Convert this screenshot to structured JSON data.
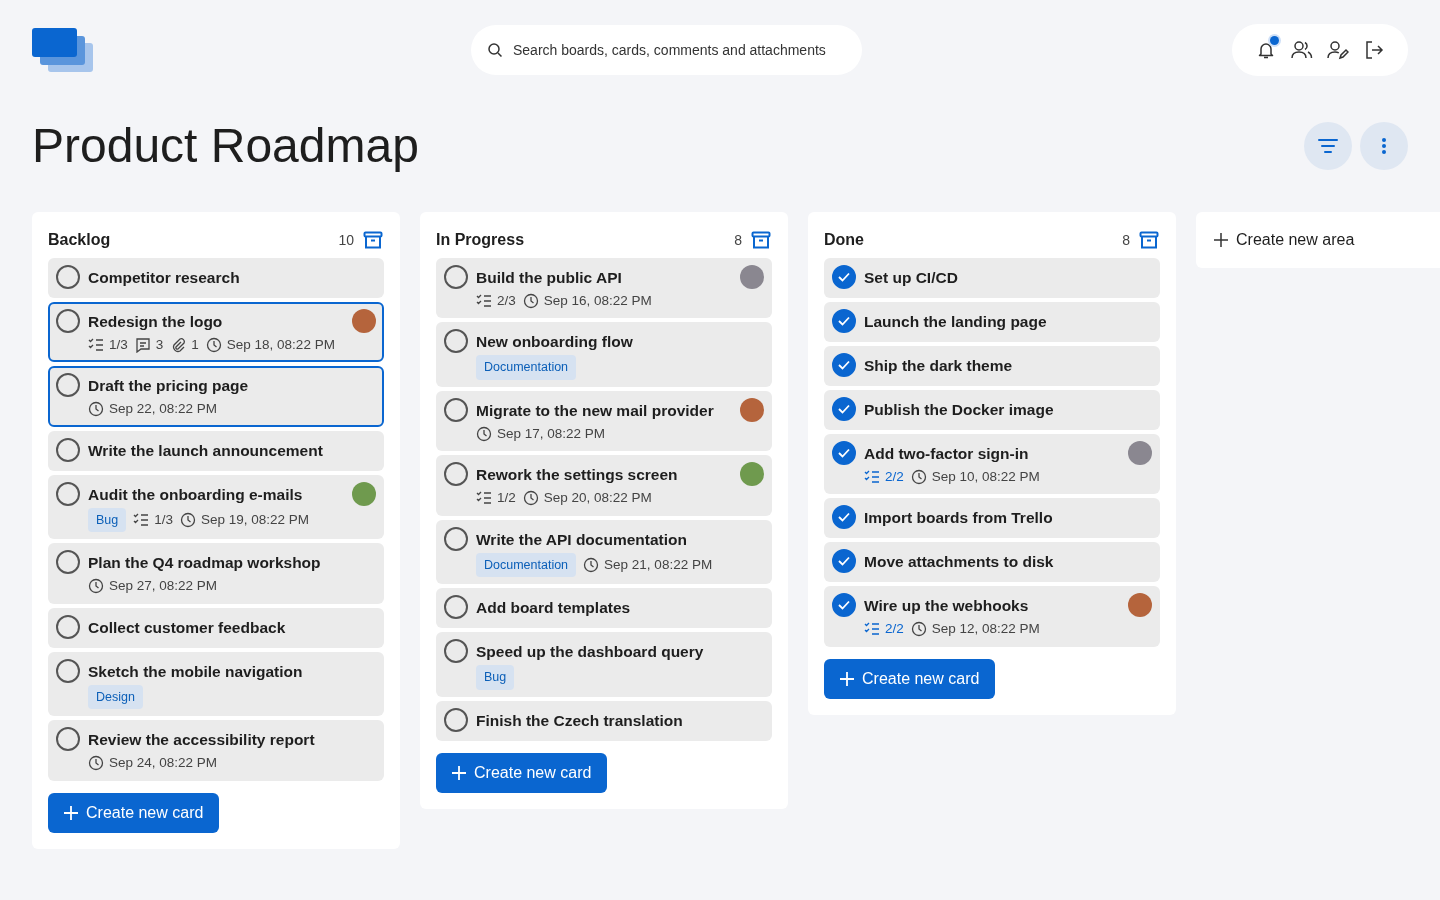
{
  "search": {
    "placeholder": "Search boards, cards, comments and attachments"
  },
  "notifications": {
    "unread": true
  },
  "board": {
    "title": "Product Roadmap"
  },
  "columns": [
    {
      "title": "Backlog",
      "count": "10",
      "cards": [
        {
          "title": "Competitor research",
          "checked": false,
          "selected": false
        },
        {
          "title": "Redesign the logo",
          "checked": false,
          "selected": true,
          "avatar": {
            "color": "#b5643c"
          },
          "meta": [
            {
              "kind": "checklist",
              "text": "1/3",
              "complete": false
            },
            {
              "kind": "comments",
              "text": "3"
            },
            {
              "kind": "attachments",
              "text": "1"
            },
            {
              "kind": "due",
              "text": "Sep 18, 08:22 PM"
            }
          ]
        },
        {
          "title": "Draft the pricing page",
          "checked": false,
          "selected": true,
          "meta": [
            {
              "kind": "due",
              "text": "Sep 22, 08:22 PM"
            }
          ]
        },
        {
          "title": "Write the launch announcement",
          "checked": false,
          "selected": false
        },
        {
          "title": "Audit the onboarding e-mails",
          "checked": false,
          "selected": false,
          "avatar": {
            "color": "#6f9a4e"
          },
          "meta": [
            {
              "kind": "label",
              "text": "Bug"
            },
            {
              "kind": "checklist",
              "text": "1/3",
              "complete": false
            },
            {
              "kind": "due",
              "text": "Sep 19, 08:22 PM"
            }
          ]
        },
        {
          "title": "Plan the Q4 roadmap workshop",
          "checked": false,
          "selected": false,
          "meta": [
            {
              "kind": "due",
              "text": "Sep 27, 08:22 PM"
            }
          ]
        },
        {
          "title": "Collect customer feedback",
          "checked": false,
          "selected": false
        },
        {
          "title": "Sketch the mobile navigation",
          "checked": false,
          "selected": false,
          "meta": [
            {
              "kind": "label",
              "text": "Design"
            }
          ]
        },
        {
          "title": "Review the accessibility report",
          "checked": false,
          "selected": false,
          "meta": [
            {
              "kind": "due",
              "text": "Sep 24, 08:22 PM"
            }
          ]
        }
      ],
      "button": "Create new card"
    },
    {
      "title": "In Progress",
      "count": "8",
      "cards": [
        {
          "title": "Build the public API",
          "checked": false,
          "selected": false,
          "avatar": {
            "color": "#8a8790"
          },
          "meta": [
            {
              "kind": "checklist",
              "text": "2/3",
              "complete": false
            },
            {
              "kind": "due",
              "text": "Sep 16, 08:22 PM"
            }
          ]
        },
        {
          "title": "New onboarding flow",
          "checked": false,
          "selected": false,
          "meta": [
            {
              "kind": "label",
              "text": "Documentation"
            }
          ]
        },
        {
          "title": "Migrate to the new mail provider",
          "checked": false,
          "selected": false,
          "avatar": {
            "color": "#b5643c"
          },
          "meta": [
            {
              "kind": "due",
              "text": "Sep 17, 08:22 PM"
            }
          ]
        },
        {
          "title": "Rework the settings screen",
          "checked": false,
          "selected": false,
          "avatar": {
            "color": "#6f9a4e"
          },
          "meta": [
            {
              "kind": "checklist",
              "text": "1/2",
              "complete": false
            },
            {
              "kind": "due",
              "text": "Sep 20, 08:22 PM"
            }
          ]
        },
        {
          "title": "Write the API documentation",
          "checked": false,
          "selected": false,
          "meta": [
            {
              "kind": "label",
              "text": "Documentation"
            },
            {
              "kind": "due",
              "text": "Sep 21, 08:22 PM"
            }
          ]
        },
        {
          "title": "Add board templates",
          "checked": false,
          "selected": false
        },
        {
          "title": "Speed up the dashboard query",
          "checked": false,
          "selected": false,
          "meta": [
            {
              "kind": "label",
              "text": "Bug"
            }
          ]
        },
        {
          "title": "Finish the Czech translation",
          "checked": false,
          "selected": false
        }
      ],
      "button": "Create new card"
    },
    {
      "title": "Done",
      "count": "8",
      "cards": [
        {
          "title": "Set up CI/CD",
          "checked": true,
          "selected": false
        },
        {
          "title": "Launch the landing page",
          "checked": true,
          "selected": false
        },
        {
          "title": "Ship the dark theme",
          "checked": true,
          "selected": false
        },
        {
          "title": "Publish the Docker image",
          "checked": true,
          "selected": false
        },
        {
          "title": "Add two-factor sign-in",
          "checked": true,
          "selected": false,
          "avatar": {
            "color": "#8a8790"
          },
          "meta": [
            {
              "kind": "checklist",
              "text": "2/2",
              "complete": true
            },
            {
              "kind": "due",
              "text": "Sep 10, 08:22 PM"
            }
          ]
        },
        {
          "title": "Import boards from Trello",
          "checked": true,
          "selected": false
        },
        {
          "title": "Move attachments to disk",
          "checked": true,
          "selected": false
        },
        {
          "title": "Wire up the webhooks",
          "checked": true,
          "selected": false,
          "avatar": {
            "color": "#b5643c"
          },
          "meta": [
            {
              "kind": "checklist",
              "text": "2/2",
              "complete": true
            },
            {
              "kind": "due",
              "text": "Sep 12, 08:22 PM"
            }
          ]
        }
      ],
      "button": "Create new card"
    }
  ],
  "new_area": {
    "label": "Create new area"
  }
}
